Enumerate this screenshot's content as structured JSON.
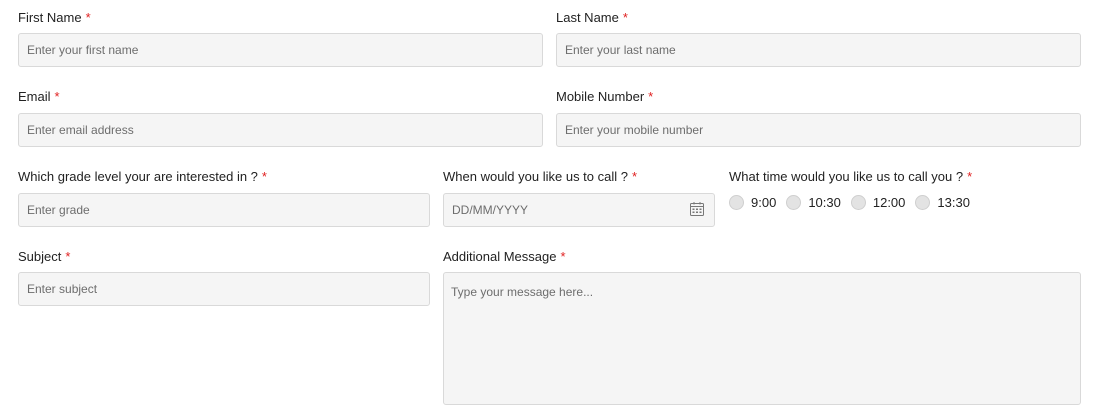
{
  "form": {
    "required_mark": "*",
    "first_name": {
      "label": "First Name",
      "placeholder": "Enter your first name",
      "value": ""
    },
    "last_name": {
      "label": "Last Name",
      "placeholder": "Enter your last name",
      "value": ""
    },
    "email": {
      "label": "Email",
      "placeholder": "Enter email address",
      "value": ""
    },
    "mobile": {
      "label": "Mobile Number",
      "placeholder": "Enter your mobile number",
      "value": ""
    },
    "grade": {
      "label": "Which grade level your are interested in ?",
      "placeholder": "Enter grade",
      "value": ""
    },
    "call_date": {
      "label": "When would you like us to call ?",
      "placeholder": "DD/MM/YYYY",
      "value": "",
      "icon": "calendar-icon"
    },
    "call_time": {
      "label": "What time would you like us to call you ?",
      "options": [
        "9:00",
        "10:30",
        "12:00",
        "13:30"
      ],
      "selected": null
    },
    "subject": {
      "label": "Subject",
      "placeholder": "Enter subject",
      "value": ""
    },
    "message": {
      "label": "Additional Message",
      "placeholder": "Type your message here...",
      "value": ""
    }
  },
  "colors": {
    "required": "#e02020",
    "input_background": "#f5f5f5",
    "input_border": "#d9d9d9"
  }
}
